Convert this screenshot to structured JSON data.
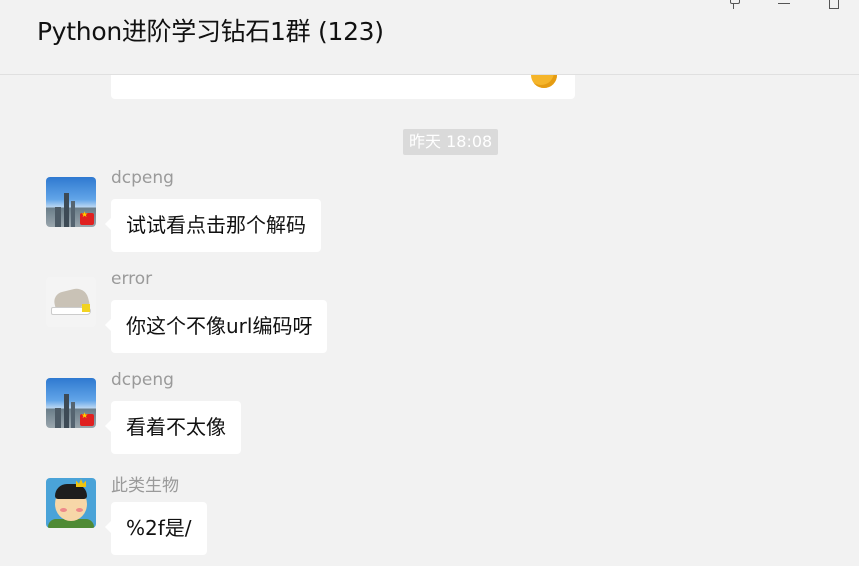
{
  "window": {
    "title": "Python进阶学习钻石1群 (123)",
    "controls": {
      "pin_icon": "pin-icon",
      "minimize_icon": "minimize-icon",
      "maximize_icon": "maximize-icon"
    }
  },
  "chat": {
    "time_separator": "昨天 18:08",
    "messages": [
      {
        "sender": "dcpeng",
        "text": "试试看点击那个解码",
        "avatar": "city-skyline-avatar"
      },
      {
        "sender": "error",
        "text": "你这个不像url编码呀",
        "avatar": "sneaker-avatar"
      },
      {
        "sender": "dcpeng",
        "text": "看着不太像",
        "avatar": "city-skyline-avatar"
      },
      {
        "sender": "此类生物",
        "text": "%2f是/",
        "avatar": "cartoon-king-avatar"
      }
    ]
  },
  "colors": {
    "background": "#f2f2f2",
    "bubble": "#ffffff",
    "sender_name": "#9a9a9a",
    "timestamp_bg": "#dadada"
  }
}
